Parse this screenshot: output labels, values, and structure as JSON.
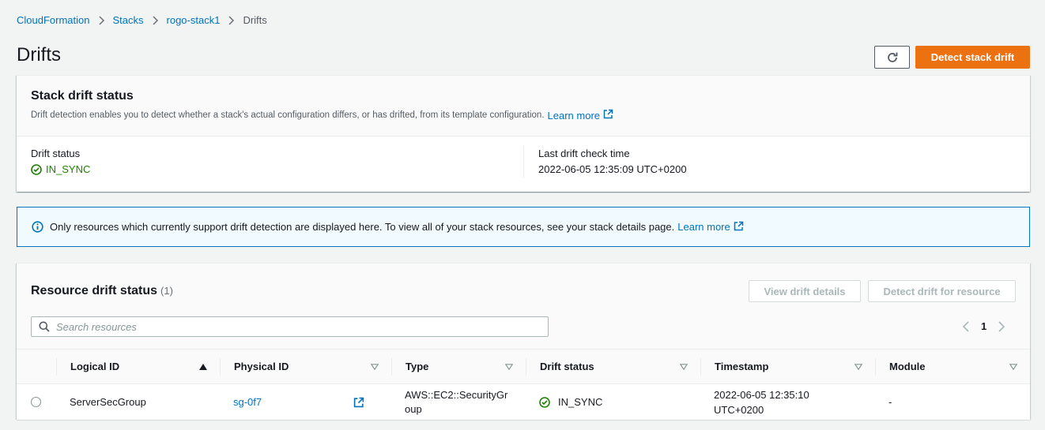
{
  "breadcrumb": {
    "items": [
      "CloudFormation",
      "Stacks",
      "rogo-stack1"
    ],
    "current": "Drifts"
  },
  "page": {
    "title": "Drifts",
    "detect_stack_drift_label": "Detect stack drift"
  },
  "stack_drift": {
    "title": "Stack drift status",
    "description": "Drift detection enables you to detect whether a stack's actual configuration differs, or has drifted, from its template configuration.",
    "learn_more": "Learn more",
    "drift_status_label": "Drift status",
    "drift_status_value": "IN_SYNC",
    "last_check_label": "Last drift check time",
    "last_check_value": "2022-06-05 12:35:09 UTC+0200"
  },
  "info_alert": {
    "text": "Only resources which currently support drift detection are displayed here. To view all of your stack resources, see your stack details page.",
    "learn_more": "Learn more"
  },
  "resources": {
    "title": "Resource drift status",
    "count": "(1)",
    "view_details_label": "View drift details",
    "detect_resource_label": "Detect drift for resource",
    "search_placeholder": "Search resources",
    "page": "1",
    "columns": [
      "Logical ID",
      "Physical ID",
      "Type",
      "Drift status",
      "Timestamp",
      "Module"
    ],
    "rows": [
      {
        "logical_id": "ServerSecGroup",
        "physical_id": "sg-0f7",
        "type": "AWS::EC2::SecurityGroup",
        "drift_status": "IN_SYNC",
        "timestamp": "2022-06-05 12:35:10 UTC+0200",
        "module": "-"
      }
    ]
  },
  "colors": {
    "primary": "#ec7211",
    "link": "#0073bb",
    "success": "#1d8102",
    "info_bg": "#f1faff"
  }
}
